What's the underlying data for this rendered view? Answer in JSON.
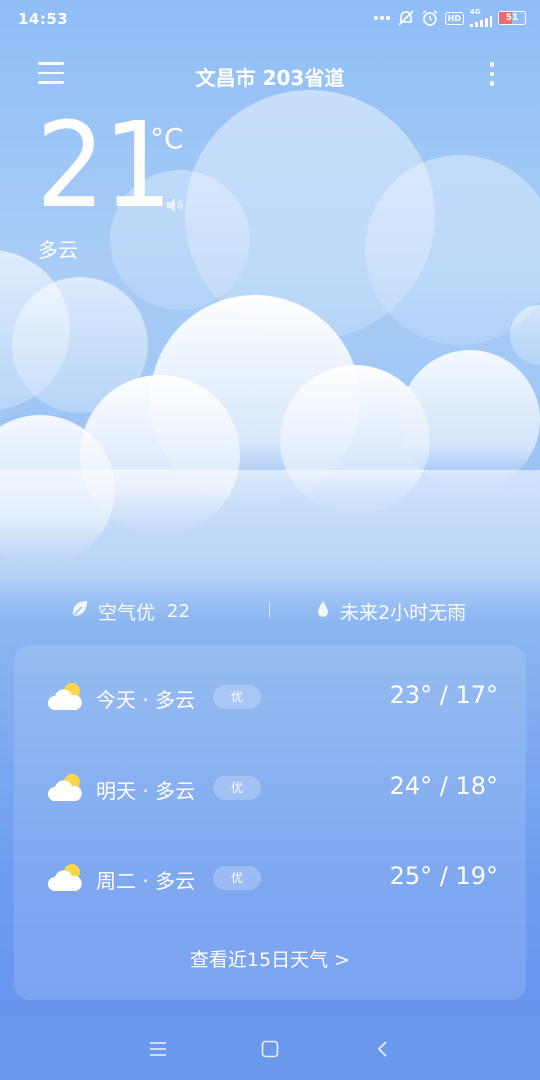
{
  "status_bar": {
    "time": "14:53",
    "network": "4G",
    "hd_label": "HD",
    "battery": "51",
    "battery_level": 0.51,
    "icons": [
      "more-dots-icon",
      "mute-icon",
      "alarm-icon",
      "hd-icon",
      "signal-icon",
      "battery-icon"
    ]
  },
  "header": {
    "location": "文昌市 203省道",
    "menu_icon": "hamburger-icon",
    "more_icon": "more-vertical-icon"
  },
  "current": {
    "temperature": "21",
    "unit": "°C",
    "condition": "多云",
    "speaker_icon": "speaker-icon"
  },
  "air": {
    "label": "空气优",
    "aqi": "22",
    "rain_text": "未来2小时无雨",
    "leaf_icon": "leaf-icon",
    "drop_icon": "raindrop-icon"
  },
  "forecast": [
    {
      "label": "今天 · 多云",
      "badge": "优",
      "range": "23° / 17°",
      "icon": "partly-cloudy-icon"
    },
    {
      "label": "明天 · 多云",
      "badge": "优",
      "range": "24° / 18°",
      "icon": "partly-cloudy-icon"
    },
    {
      "label": "周二 · 多云",
      "badge": "优",
      "range": "25° / 19°",
      "icon": "partly-cloudy-icon"
    }
  ],
  "more_link": "查看近15日天气  >",
  "nav": {
    "menu_icon": "recents-icon",
    "home_icon": "home-icon",
    "back_icon": "back-icon"
  },
  "colors": {
    "sky_top": "#8fbdf6",
    "sky_bottom": "#6592ec",
    "sun": "#f7d64a",
    "cloud": "#ffffff"
  }
}
